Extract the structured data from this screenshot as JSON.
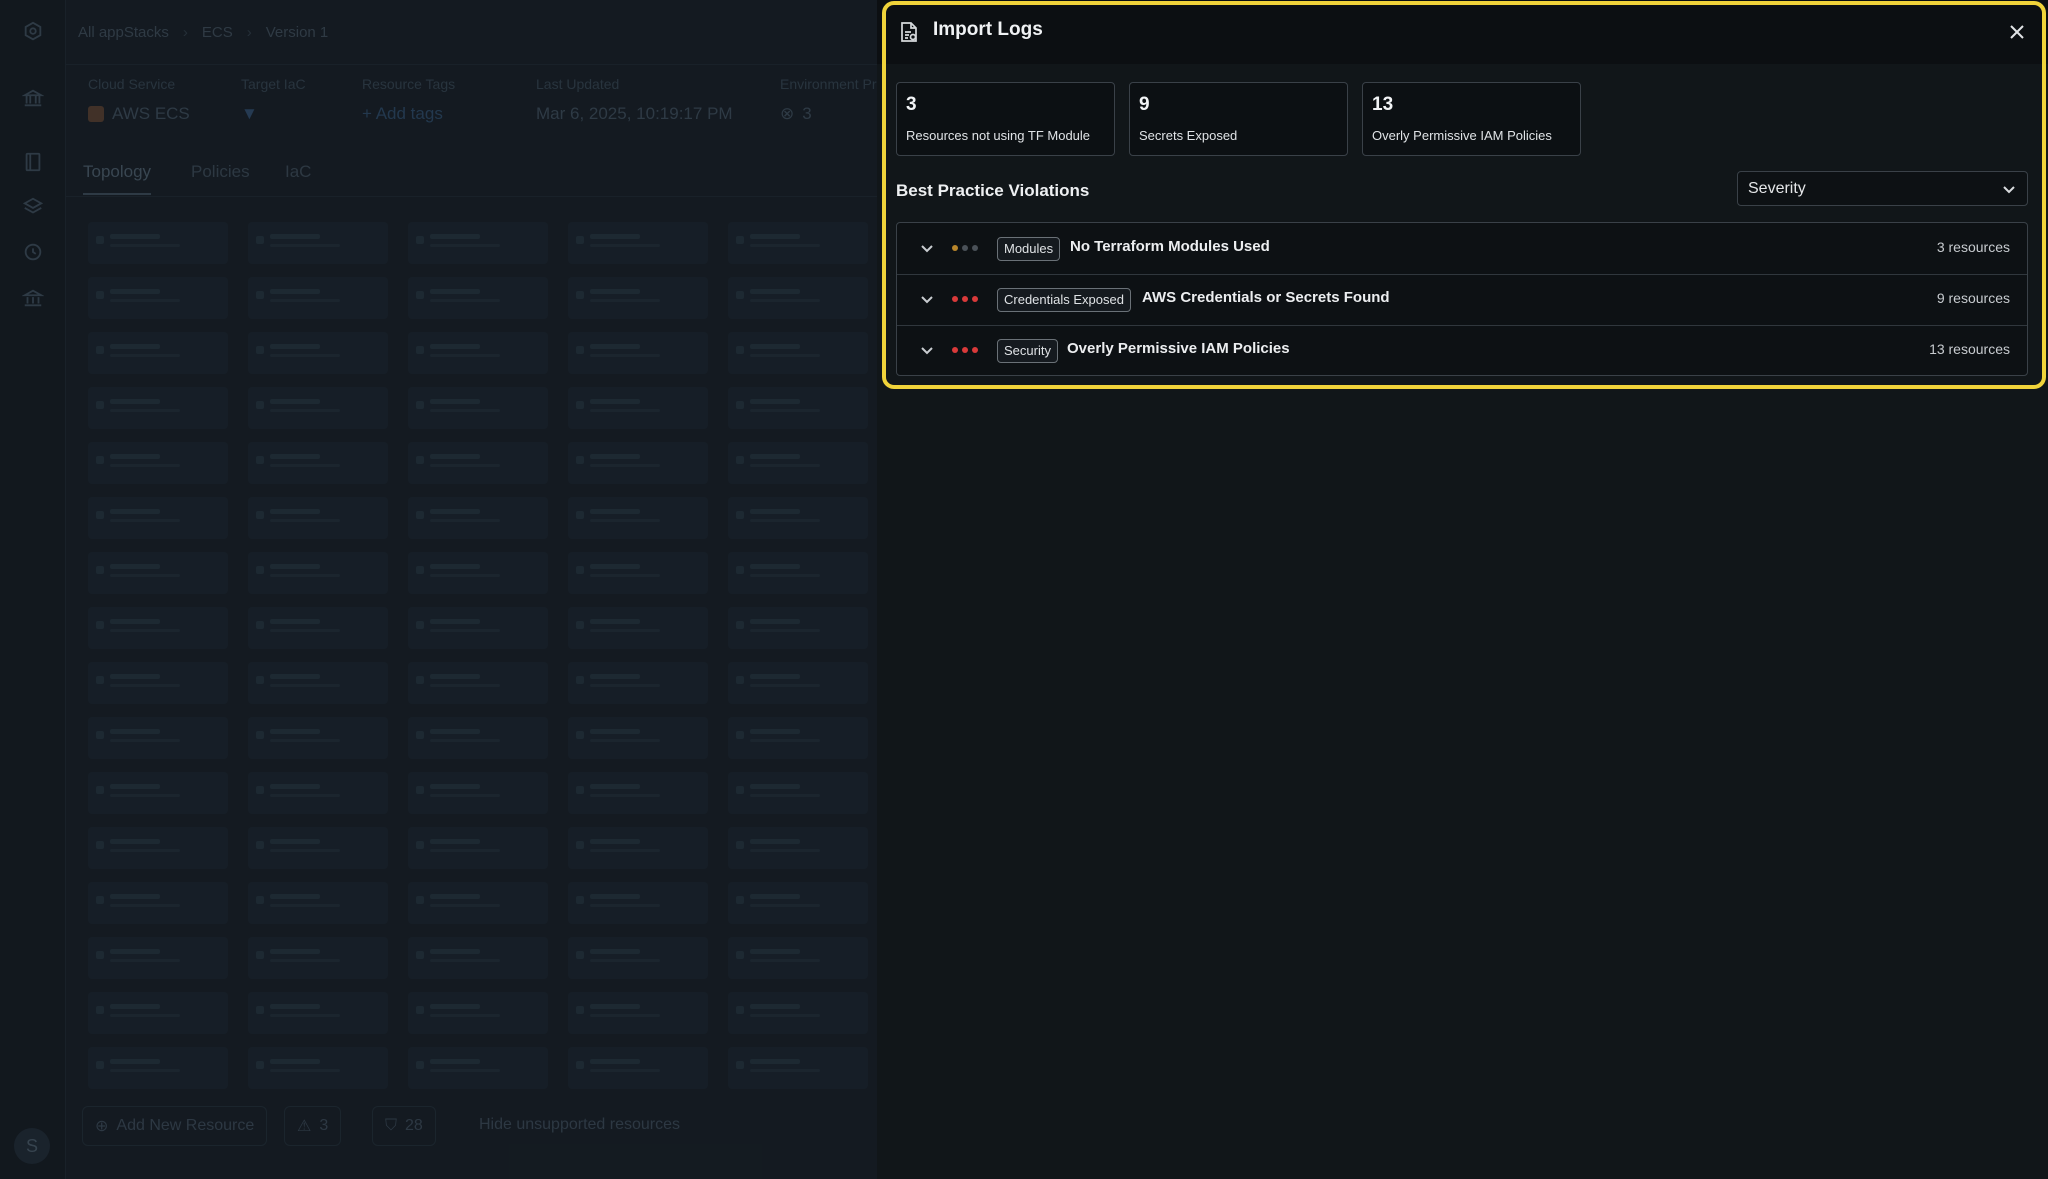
{
  "breadcrumb": {
    "items": [
      "All appStacks",
      "ECS",
      "Version 1"
    ]
  },
  "meta": {
    "cloud_service_label": "Cloud Service",
    "cloud_service_value": "AWS ECS",
    "target_iac_label": "Target IaC",
    "resource_tags_label": "Resource Tags",
    "add_tags_label": "+ Add tags",
    "last_updated_label": "Last Updated",
    "last_updated_value": "Mar 6, 2025, 10:19:17 PM",
    "environment_label": "Environment Pr",
    "environment_count": "3"
  },
  "tabs": [
    "Topology",
    "Policies",
    "IaC"
  ],
  "bottom_bar": {
    "add_resource_label": "Add New Resource",
    "warnings_count": "3",
    "policy_count": "28",
    "hide_unsupported_label": "Hide unsupported resources"
  },
  "user": {
    "avatar_initial": "S"
  },
  "panel": {
    "title": "Import Logs",
    "stats": [
      {
        "value": "3",
        "label": "Resources not using TF Module"
      },
      {
        "value": "9",
        "label": "Secrets Exposed"
      },
      {
        "value": "13",
        "label": "Overly Permissive IAM Policies"
      }
    ],
    "section_title": "Best Practice Violations",
    "filter": {
      "selected": "Severity"
    },
    "violations": [
      {
        "badge": "Modules",
        "title": "No Terraform Modules Used",
        "count": "3 resources",
        "severity_dots": [
          "#b8862b",
          "#4a5158",
          "#4a5158"
        ]
      },
      {
        "badge": "Credentials Exposed",
        "title": "AWS Credentials or Secrets Found",
        "count": "9 resources",
        "severity_dots": [
          "#d93a3a",
          "#d93a3a",
          "#d93a3a"
        ]
      },
      {
        "badge": "Security",
        "title": "Overly Permissive IAM Policies",
        "count": "13 resources",
        "severity_dots": [
          "#d93a3a",
          "#d93a3a",
          "#d93a3a"
        ]
      }
    ]
  },
  "colors": {
    "highlight": "#f0d33a",
    "panel_bg": "#111619",
    "accent_tag": "#2f6fa8"
  }
}
